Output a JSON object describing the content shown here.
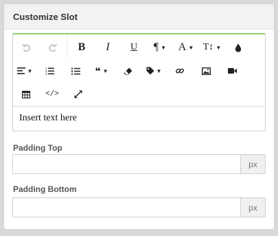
{
  "panel": {
    "title": "Customize Slot"
  },
  "toolbar": {
    "row1": [
      {
        "name": "undo-button",
        "icon": "undo-icon",
        "glyph": "↶",
        "disabled": true
      },
      {
        "name": "redo-button",
        "icon": "redo-icon",
        "glyph": "↷",
        "disabled": true
      },
      {
        "name": "bold-button",
        "icon": "bold-icon",
        "glyph": "B"
      },
      {
        "name": "italic-button",
        "icon": "italic-icon",
        "glyph": "I"
      },
      {
        "name": "underline-button",
        "icon": "underline-icon",
        "glyph": "U"
      },
      {
        "name": "paragraph-dropdown",
        "icon": "pilcrow-icon",
        "glyph": "¶"
      },
      {
        "name": "font-dropdown",
        "icon": "font-icon",
        "glyph": "A"
      },
      {
        "name": "font-size-dropdown",
        "icon": "text-height-icon",
        "glyph": "T↕"
      },
      {
        "name": "color-button",
        "icon": "droplet-icon",
        "glyph": "●"
      }
    ],
    "row2": [
      {
        "name": "align-dropdown",
        "icon": "align-left-icon"
      },
      {
        "name": "ordered-list-button",
        "icon": "ordered-list-icon"
      },
      {
        "name": "unordered-list-button",
        "icon": "unordered-list-icon"
      },
      {
        "name": "quote-dropdown",
        "icon": "quote-icon",
        "glyph": "❝"
      },
      {
        "name": "clear-format-button",
        "icon": "eraser-icon"
      },
      {
        "name": "tag-dropdown",
        "icon": "tag-icon"
      },
      {
        "name": "link-button",
        "icon": "link-icon"
      },
      {
        "name": "image-button",
        "icon": "image-icon"
      },
      {
        "name": "video-button",
        "icon": "video-camera-icon"
      }
    ],
    "row3": [
      {
        "name": "table-button",
        "icon": "table-icon"
      },
      {
        "name": "code-view-button",
        "icon": "code-icon",
        "glyph": "</>"
      },
      {
        "name": "fullscreen-button",
        "icon": "expand-icon"
      }
    ]
  },
  "editor": {
    "content": "Insert text here"
  },
  "padding_top": {
    "label": "Padding Top",
    "value": "",
    "unit": "px"
  },
  "padding_bottom": {
    "label": "Padding Bottom",
    "value": "",
    "unit": "px"
  },
  "colors": {
    "accent_border": "#8fd06a",
    "background": "#d9d9d9",
    "header_bg": "#f2f2f2"
  }
}
